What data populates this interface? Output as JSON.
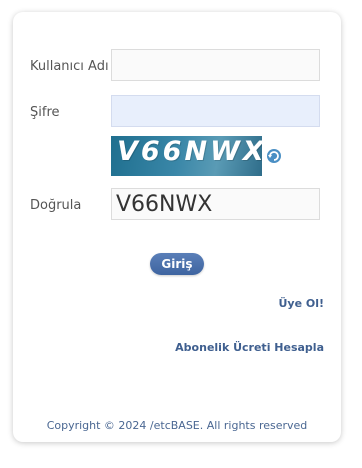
{
  "form": {
    "username_label": "Kullanıcı Adı",
    "username_value": "",
    "password_label": "Şifre",
    "password_value": "",
    "captcha_text": "V66NWX",
    "verify_label": "Doğrula",
    "verify_value": "V66NWX",
    "login_button": "Giriş"
  },
  "links": {
    "register": "Üye Ol!",
    "subscription_fee": "Abonelik Ücreti Hesapla"
  },
  "footer": {
    "copyright": "Copyright © 2024 /etcBASE. All rights reserved"
  },
  "icons": {
    "refresh": "refresh-icon"
  },
  "colors": {
    "accent": "#3e64a0",
    "link": "#3f5f8f",
    "password_bg": "#e8effc"
  }
}
